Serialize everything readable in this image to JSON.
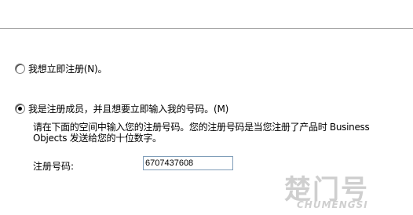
{
  "options": {
    "register_now": {
      "label": "我想立即注册(N)。",
      "selected": false
    },
    "registered_member": {
      "label": "我是注册成员，并且想要立即输入我的号码。(M)",
      "selected": true
    }
  },
  "description": {
    "line1": "请在下面的空间中输入您的注册号码。您的注册号码是当您注册了产品时 Business",
    "line2": "Objects 发送给您的十位数字。"
  },
  "serial": {
    "label": "注册号码:",
    "value": "6707437608"
  },
  "watermark": {
    "mark": "楚门号",
    "text": "CHUMENGSI"
  }
}
